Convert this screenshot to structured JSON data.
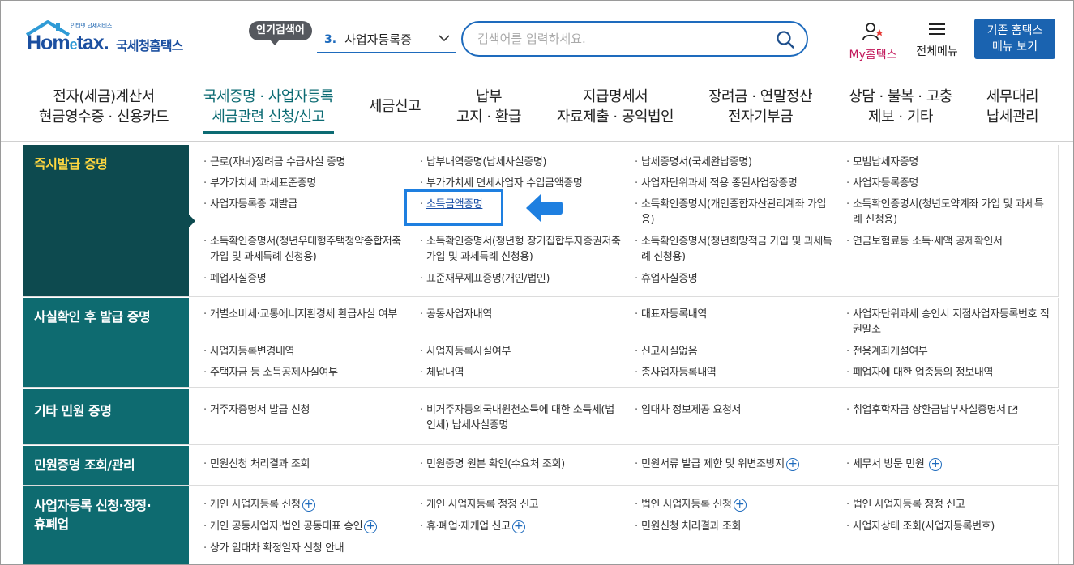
{
  "header": {
    "logo_small": "인터넷 납세서비스",
    "logo_brand": "Hometax.",
    "logo_brand_parts": [
      "Hom",
      "e",
      "tax."
    ],
    "logo_kr": "국세청홈택스",
    "hot_label": "인기검색어",
    "hot_num": "3.",
    "hot_term": "사업자등록증",
    "search_placeholder": "검색어를 입력하세요.",
    "my_label": "My홈택스",
    "all_label": "전체메뉴",
    "old_menu_line1": "기존 홈택스",
    "old_menu_line2": "메뉴 보기"
  },
  "nav": [
    {
      "l1": "전자(세금)계산서",
      "l2": "현금영수증 · 신용카드"
    },
    {
      "l1": "국세증명 · 사업자등록",
      "l2": "세금관련 신청/신고"
    },
    {
      "l1": "세금신고",
      "l2": ""
    },
    {
      "l1": "납부",
      "l2": "고지 · 환급"
    },
    {
      "l1": "지급명세서",
      "l2": "자료제출 · 공익법인"
    },
    {
      "l1": "장려금 · 연말정산",
      "l2": "전자기부금"
    },
    {
      "l1": "상담 · 불복 · 고충",
      "l2": "제보 · 기타"
    },
    {
      "l1": "세무대리",
      "l2": "납세관리"
    }
  ],
  "sections": [
    {
      "title": "즉시발급 증명",
      "items": [
        "근로(자녀)장려금 수급사실 증명",
        "납부내역증명(납세사실증명)",
        "납세증명서(국세완납증명)",
        "모범납세자증명",
        "부가가치세 과세표준증명",
        "부가가치세 면세사업자 수입금액증명",
        "사업자단위과세 적용 종된사업장증명",
        "사업자등록증명",
        "사업자등록증 재발급",
        "소득금액증명",
        "소득확인증명서(개인종합자산관리계좌 가입용)",
        "소득확인증명서(청년도약계좌 가입 및 과세특례 신청용)",
        "소득확인증명서(청년우대형주택청약종합저축 가입 및 과세특례 신청용)",
        "소득확인증명서(청년형 장기집합투자증권저축 가입 및 과세특례 신청용)",
        "소득확인증명서(청년희망적금 가입 및 과세특례 신청용)",
        "연금보험료등 소득·세액 공제확인서",
        "폐업사실증명",
        "표준재무제표증명(개인/법인)",
        "휴업사실증명"
      ]
    },
    {
      "title": "사실확인 후 발급 증명",
      "items": [
        "개별소비세·교통에너지환경세 환급사실 여부",
        "공동사업자내역",
        "대표자등록내역",
        "사업자단위과세 승인시 지점사업자등록번호 직권말소",
        "사업자등록변경내역",
        "사업자등록사실여부",
        "신고사실없음",
        "전용계좌개설여부",
        "주택자금 등 소득공제사실여부",
        "체납내역",
        "총사업자등록내역",
        "폐업자에 대한 업종등의 정보내역"
      ]
    },
    {
      "title": "기타 민원 증명",
      "items": [
        "거주자증명서 발급 신청",
        "비거주자등의국내원천소득에 대한 소득세(법인세) 납세사실증명",
        "임대차 정보제공 요청서",
        "취업후학자금 상환금납부사실증명서"
      ]
    },
    {
      "title": "민원증명 조회/관리",
      "items": [
        "민원신청 처리결과 조회",
        "민원증명 원본 확인(수요처 조회)",
        "민원서류 발급 제한 및 위변조방지",
        "세무서 방문 민원"
      ]
    },
    {
      "title_l1": "사업자등록 신청·정정·",
      "title_l2": "휴폐업",
      "items": [
        "개인 사업자등록 신청",
        "개인 사업자등록 정정 신고",
        "법인 사업자등록 신청",
        "법인 사업자등록 정정 신고",
        "개인 공동사업자·법인 공동대표 승인",
        "휴·폐업·재개업 신고",
        "민원신청 처리결과 조회",
        "사업자상태 조회(사업자등록번호)",
        "상가 임대차 확정일자 신청 안내"
      ]
    }
  ],
  "colors": {
    "primary": "#1a63b0",
    "teal": "#0e6b70",
    "dark_teal": "#0d4a4f",
    "highlight": "#1e7fe0",
    "my_pink": "#c2185b"
  }
}
